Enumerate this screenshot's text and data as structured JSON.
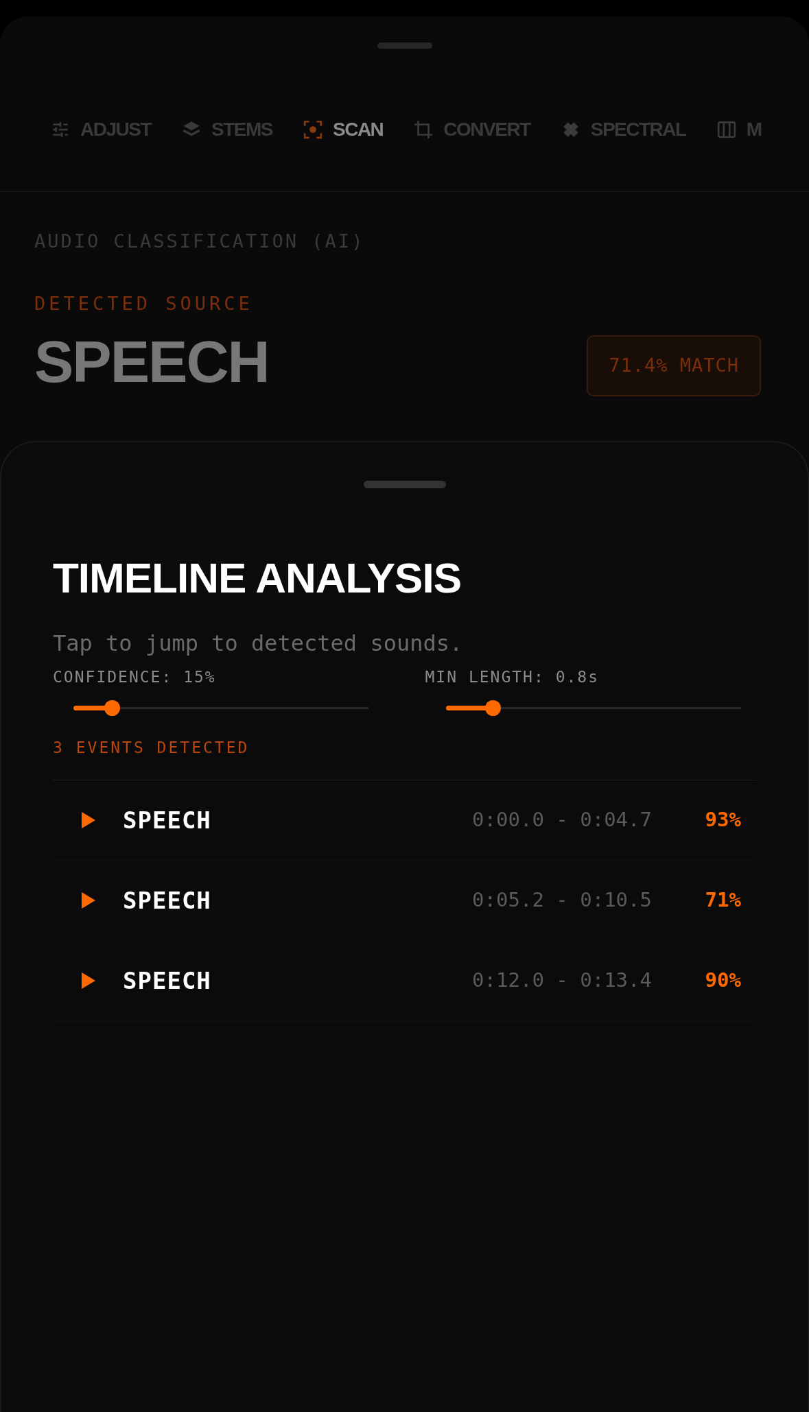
{
  "tabs": [
    {
      "label": "ADJUST",
      "selected": false
    },
    {
      "label": "STEMS",
      "selected": false
    },
    {
      "label": "SCAN",
      "selected": true
    },
    {
      "label": "CONVERT",
      "selected": false
    },
    {
      "label": "SPECTRAL",
      "selected": false
    },
    {
      "label": "M",
      "selected": false
    }
  ],
  "classification": {
    "heading": "AUDIO CLASSIFICATION (AI)",
    "source_label": "DETECTED SOURCE",
    "source": "SPEECH",
    "match": "71.4% MATCH"
  },
  "timeline": {
    "title": "TIMELINE ANALYSIS",
    "subtitle": "Tap to jump to detected sounds.",
    "sliders": [
      {
        "label": "CONFIDENCE: 15%",
        "level": 0.13
      },
      {
        "label": "MIN LENGTH: 0.8s",
        "level": 0.16
      }
    ],
    "events_count": "3 EVENTS DETECTED",
    "events": [
      {
        "label": "SPEECH",
        "range": "0:00.0 - 0:04.7",
        "confidence": "93%"
      },
      {
        "label": "SPEECH",
        "range": "0:05.2 - 0:10.5",
        "confidence": "71%"
      },
      {
        "label": "SPEECH",
        "range": "0:12.0 - 0:13.4",
        "confidence": "90%"
      }
    ]
  }
}
